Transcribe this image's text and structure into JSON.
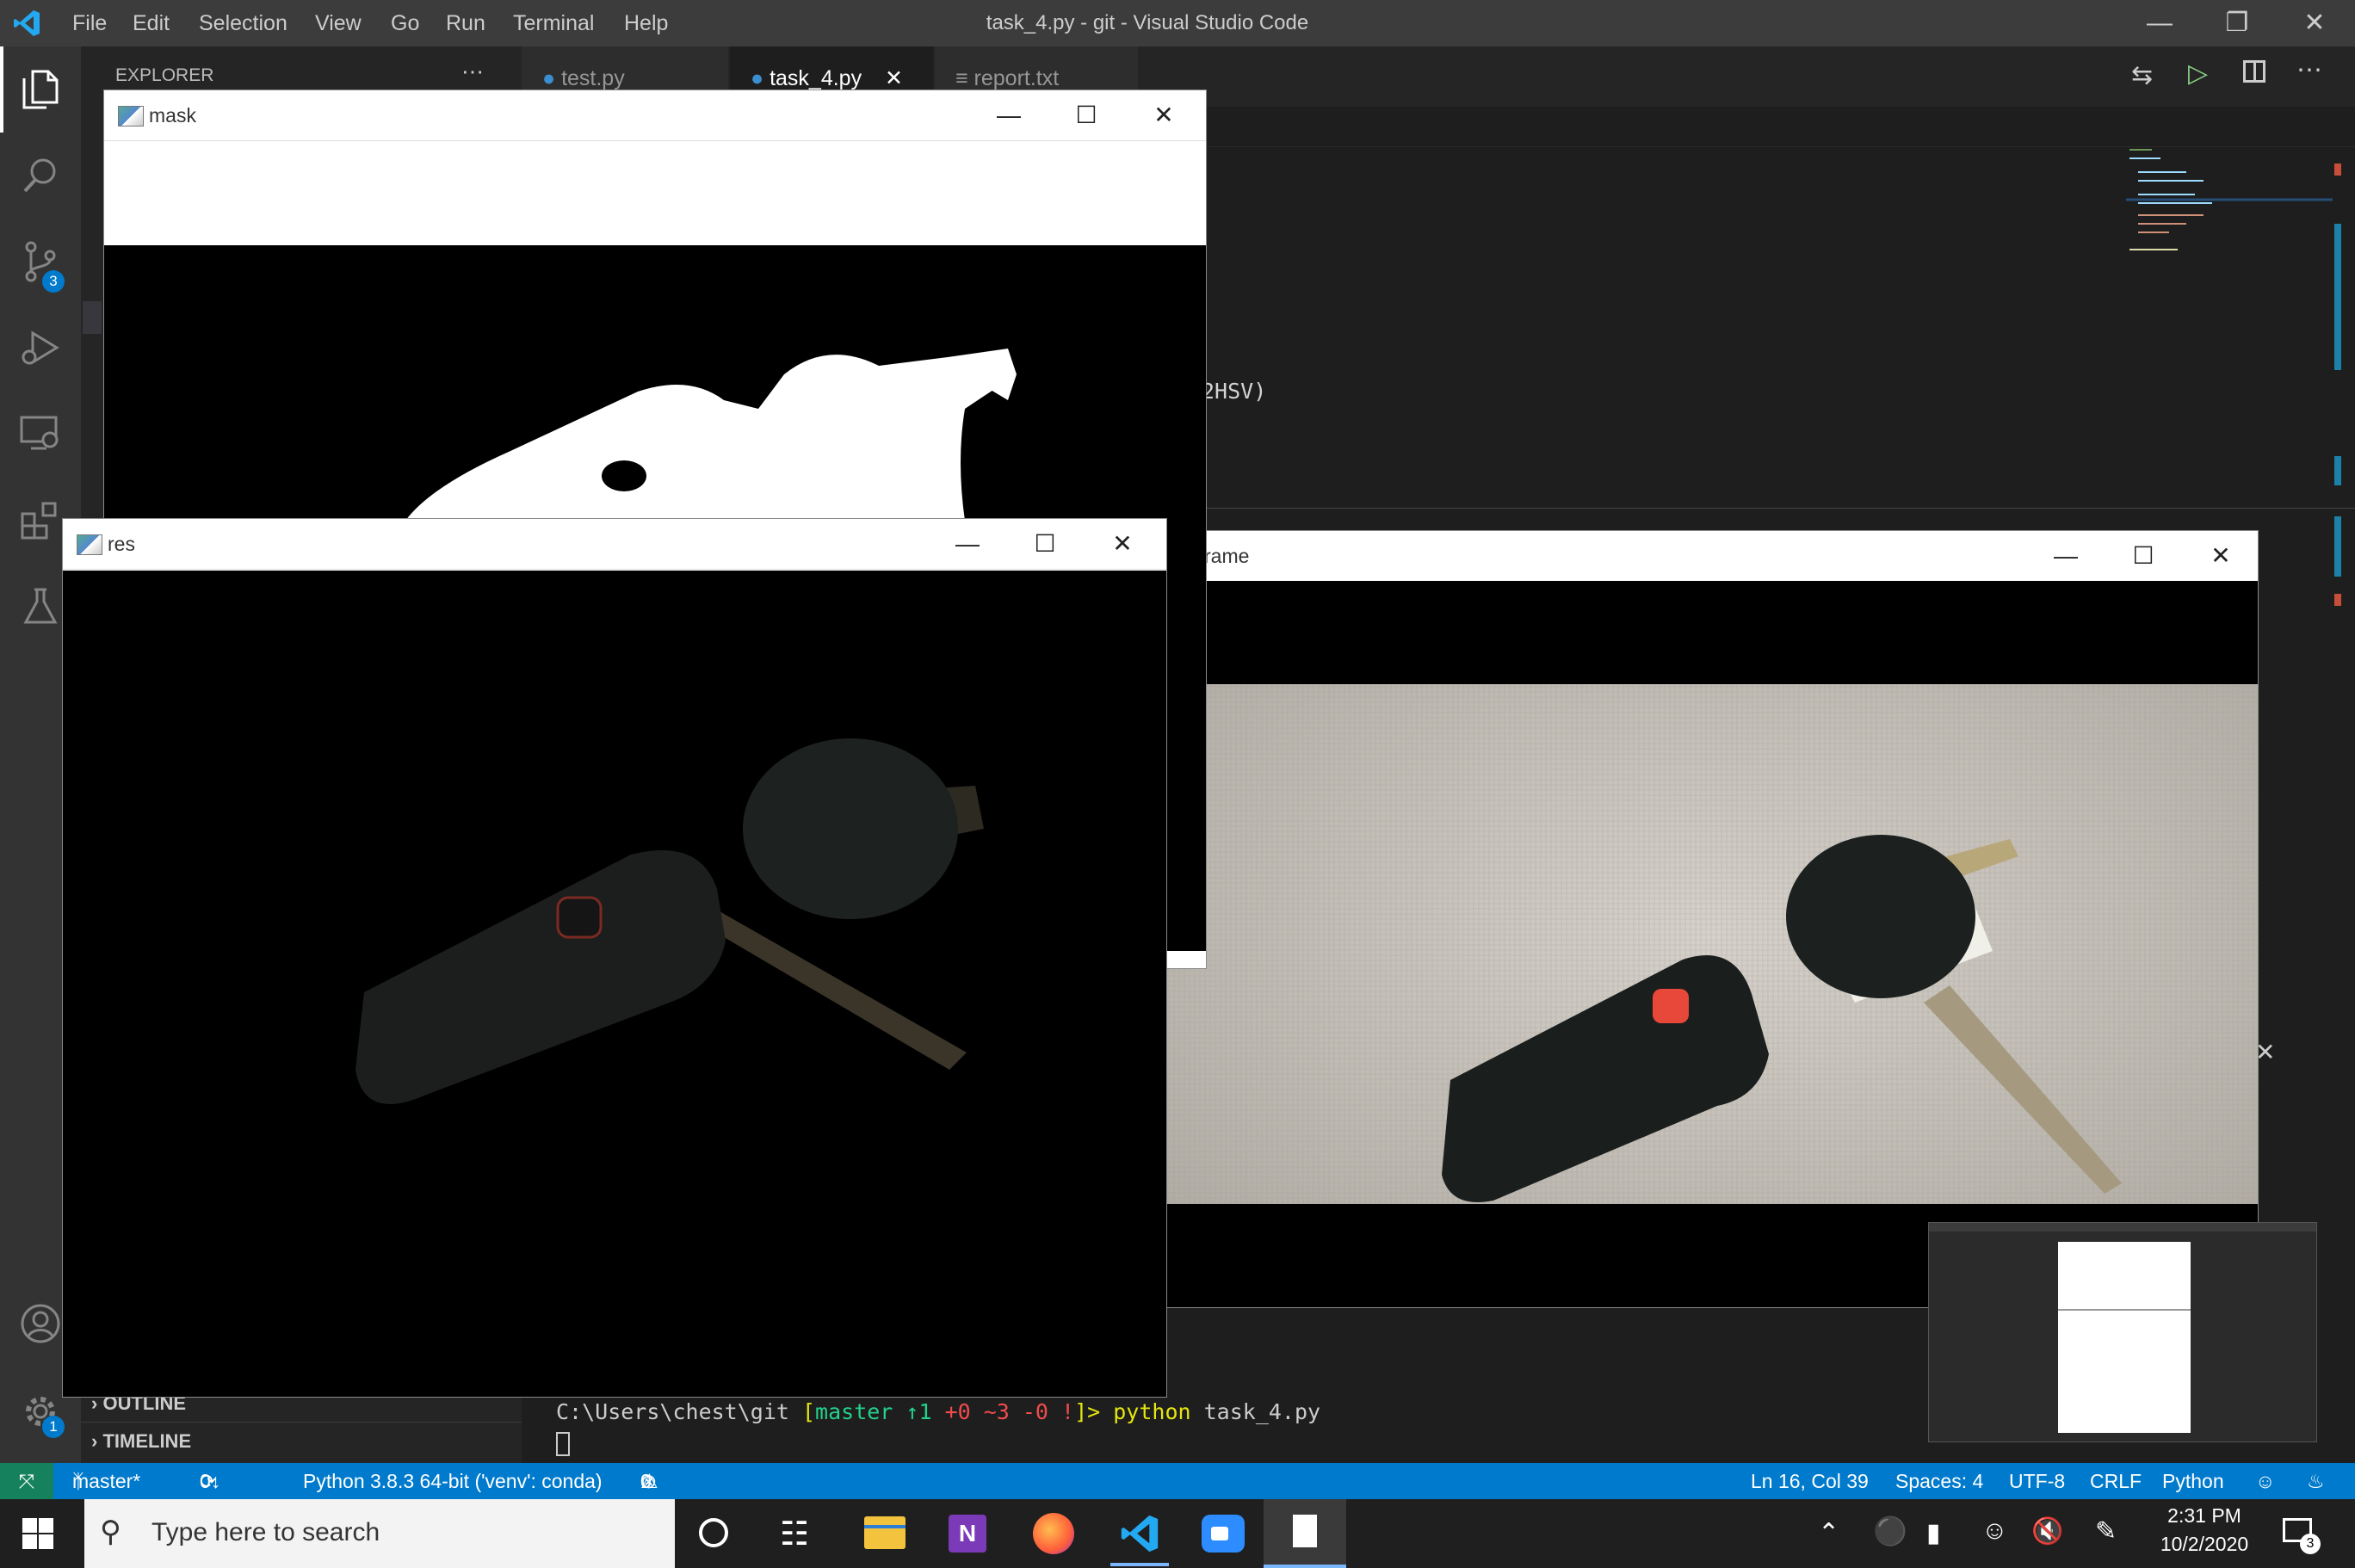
{
  "window": {
    "title": "task_4.py - git - Visual Studio Code"
  },
  "menu": [
    "File",
    "Edit",
    "Selection",
    "View",
    "Go",
    "Run",
    "Terminal",
    "Help"
  ],
  "sidebar": {
    "header": "EXPLORER",
    "sections": [
      "OUTLINE",
      "TIMELINE"
    ]
  },
  "tabs": [
    {
      "label": "test.py",
      "active": false
    },
    {
      "label": "task_4.py",
      "active": true
    },
    {
      "label": "report.txt",
      "active": false
    }
  ],
  "activity": {
    "source_control_badge": "3",
    "settings_badge": "1"
  },
  "editor": {
    "code_fragment": "2HSV)"
  },
  "terminal": {
    "prompt_path": "C:\\Users\\chest\\git ",
    "branch_open": "[",
    "branch": "master",
    "ahead": " ↑1",
    "added": " +0",
    "modified": " ~3",
    "deleted": " -0",
    "bang": " !",
    "branch_close": "]> ",
    "command": "python",
    "arg": " task_4.py"
  },
  "cv_windows": {
    "mask": "mask",
    "res": "res",
    "frame": "rame"
  },
  "statusbar": {
    "branch": "master*",
    "sync": "0↓ 1↑",
    "interpreter": "Python 3.8.3 64-bit ('venv': conda)",
    "errors": "0",
    "warnings": "0",
    "position": "Ln 16, Col 39",
    "spaces": "Spaces: 4",
    "encoding": "UTF-8",
    "eol": "CRLF",
    "language": "Python"
  },
  "taskbar": {
    "search_placeholder": "Type here to search",
    "time": "2:31 PM",
    "date": "10/2/2020",
    "notification_count": "3"
  },
  "colors": {
    "accent": "#007acc",
    "titlebar": "#3c3c3c",
    "activity": "#333333",
    "sidebar": "#252526"
  }
}
